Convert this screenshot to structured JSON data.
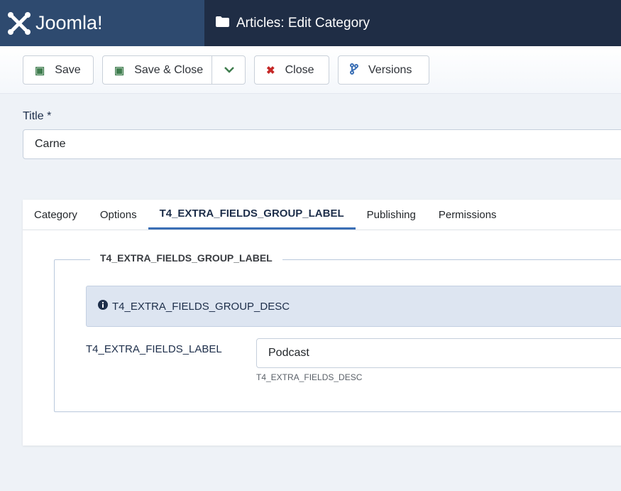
{
  "header": {
    "brand": "Joomla!",
    "page_title": "Articles: Edit Category"
  },
  "toolbar": {
    "save": "Save",
    "save_close": "Save & Close",
    "close": "Close",
    "versions": "Versions"
  },
  "form": {
    "title_label": "Title *",
    "title_value": "Carne"
  },
  "tabs": [
    "Category",
    "Options",
    "T4_EXTRA_FIELDS_GROUP_LABEL",
    "Publishing",
    "Permissions"
  ],
  "active_tab": "T4_EXTRA_FIELDS_GROUP_LABEL",
  "fieldset": {
    "legend": "T4_EXTRA_FIELDS_GROUP_LABEL",
    "alert": "T4_EXTRA_FIELDS_GROUP_DESC",
    "field_label": "T4_EXTRA_FIELDS_LABEL",
    "field_value": "Podcast",
    "field_desc": "T4_EXTRA_FIELDS_DESC"
  },
  "colors": {
    "header": "#1f2d45",
    "logo_bg": "#2e4a6f",
    "accent": "#3a6fb5",
    "save_green": "#3f7d4e",
    "close_red": "#c52827"
  }
}
